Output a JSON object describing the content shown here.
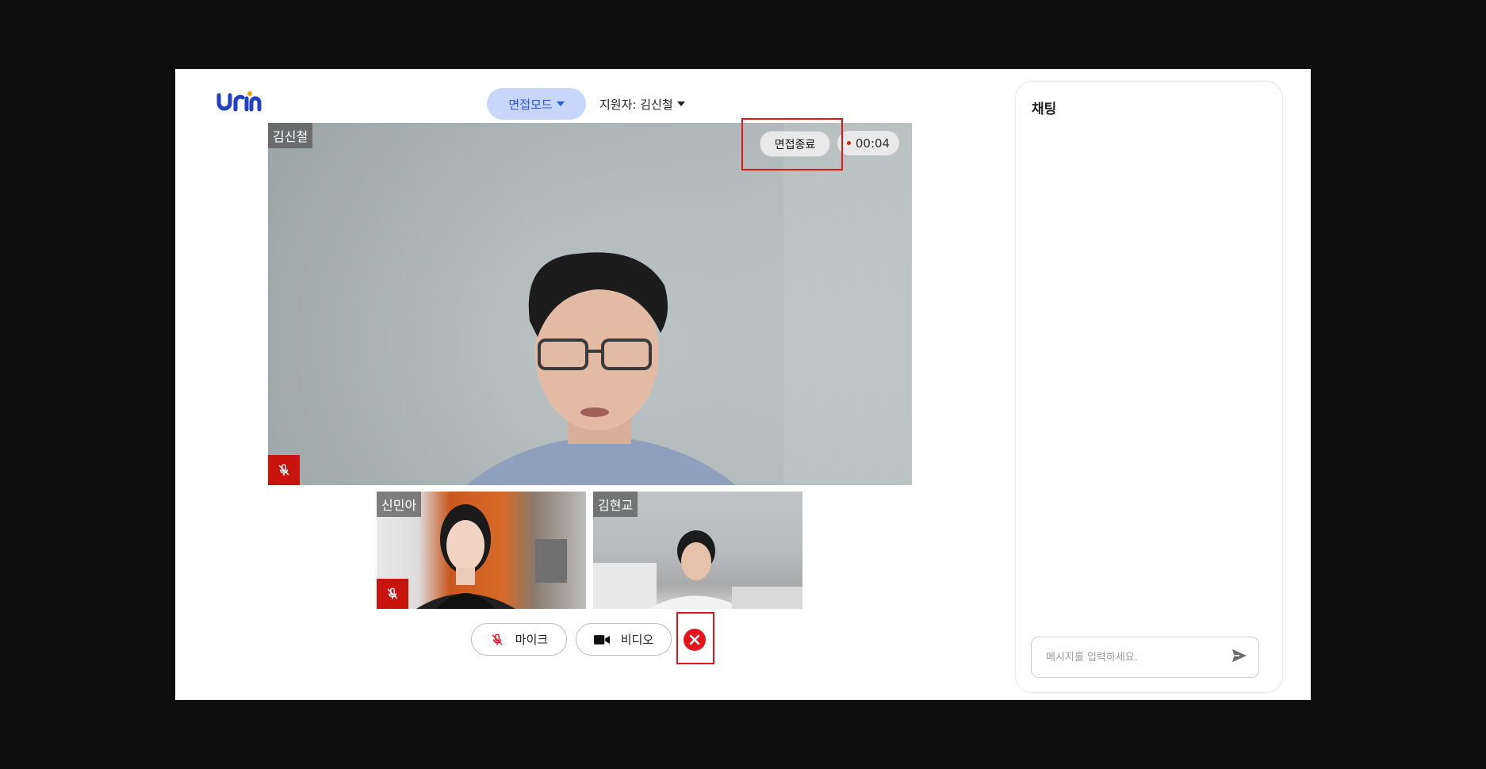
{
  "header": {
    "logo_text": "urn",
    "mode_label": "면접모드",
    "applicant_label": "지원자: 김신철"
  },
  "main_video": {
    "participant": "김신철",
    "end_button": "면접종료",
    "timer": "00:04",
    "muted": true
  },
  "thumbnails": [
    {
      "participant": "신민아",
      "muted": true
    },
    {
      "participant": "김현교",
      "muted": false
    }
  ],
  "controls": {
    "mic_label": "마이크",
    "video_label": "비디오"
  },
  "chat": {
    "title": "채팅",
    "placeholder": "메시지를 입력하세요."
  },
  "colors": {
    "accent": "#2b55d9",
    "mode_bg": "#c9d6fb",
    "mute_red": "#c8140c",
    "exit_red": "#e8141b",
    "highlight_red": "#e3141b"
  }
}
